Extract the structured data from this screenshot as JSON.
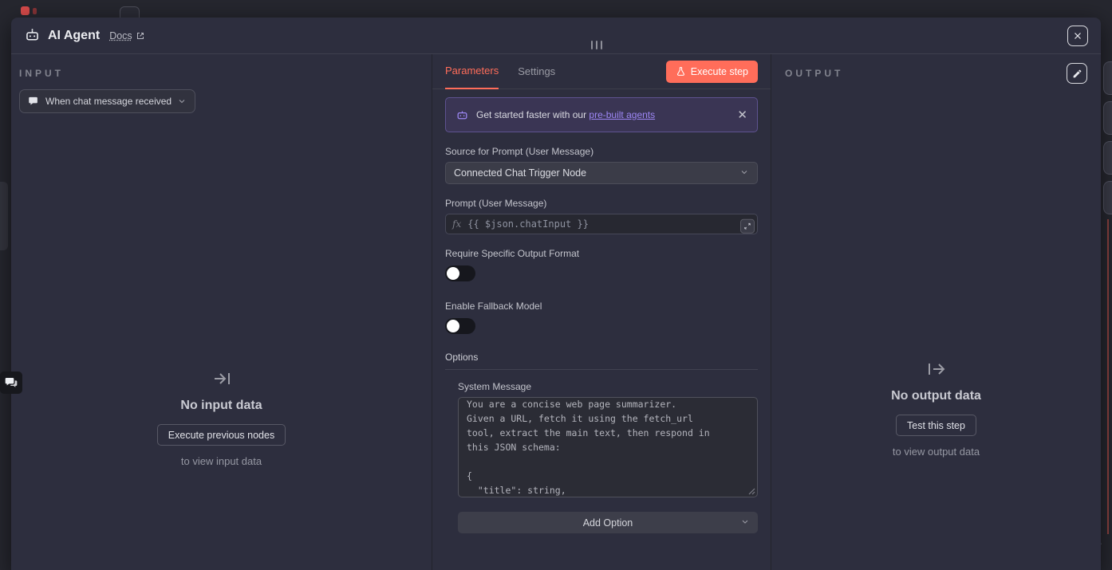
{
  "colors": {
    "accent": "#ff6d5a",
    "link_purple": "#9d87f5"
  },
  "header": {
    "title": "AI Agent",
    "docs": "Docs"
  },
  "input_panel": {
    "label": "INPUT",
    "trigger": "When chat message received",
    "empty_title": "No input data",
    "execute_button": "Execute previous nodes",
    "empty_hint": "to view input data"
  },
  "tabs": {
    "parameters": "Parameters",
    "settings": "Settings",
    "execute_step": "Execute step"
  },
  "banner": {
    "text": "Get started faster with our",
    "link": "pre-built agents",
    "close": "✕"
  },
  "form": {
    "source_label": "Source for Prompt (User Message)",
    "source_value": "Connected Chat Trigger Node",
    "prompt_label": "Prompt (User Message)",
    "prompt_fx": "fx",
    "prompt_value": "{{ $json.chatInput }}",
    "require_label": "Require Specific Output Format",
    "fallback_label": "Enable Fallback Model",
    "options_label": "Options",
    "system_label": "System Message",
    "system_value": "You are a concise web page summarizer.\nGiven a URL, fetch it using the fetch_url\ntool, extract the main text, then respond in\nthis JSON schema:\n\n{\n  \"title\": string,",
    "add_option": "Add Option"
  },
  "output_panel": {
    "label": "OUTPUT",
    "empty_title": "No output data",
    "test_button": "Test this step",
    "empty_hint": "to view output data"
  }
}
